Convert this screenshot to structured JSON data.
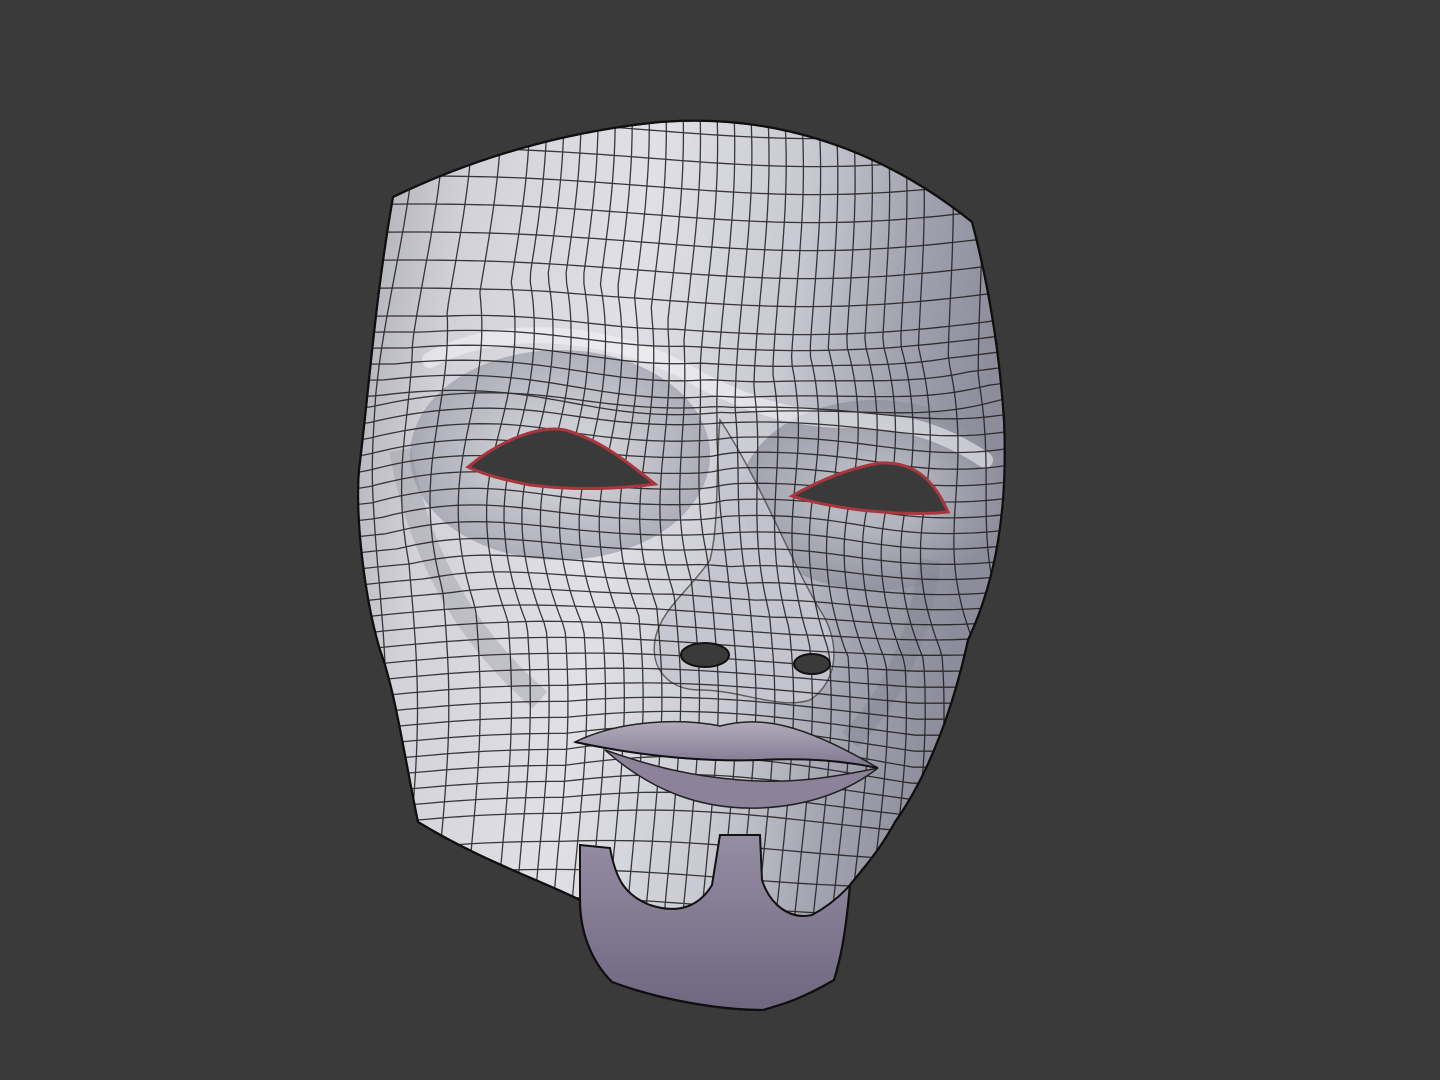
{
  "viewport": {
    "background": "#3a3a3a",
    "object": "mask-mesh",
    "shading": "solid",
    "wireframe_overlay": true,
    "colors": {
      "mask_light": "#dcdce2",
      "mask_mid": "#b9b9c2",
      "mask_shadow": "#8a8a98",
      "lips": "#9e96a8",
      "beard": "#857d92",
      "wire": "#1c1c1c",
      "eye_rim": "#a8363c",
      "hole": "#3a3a3a"
    }
  }
}
